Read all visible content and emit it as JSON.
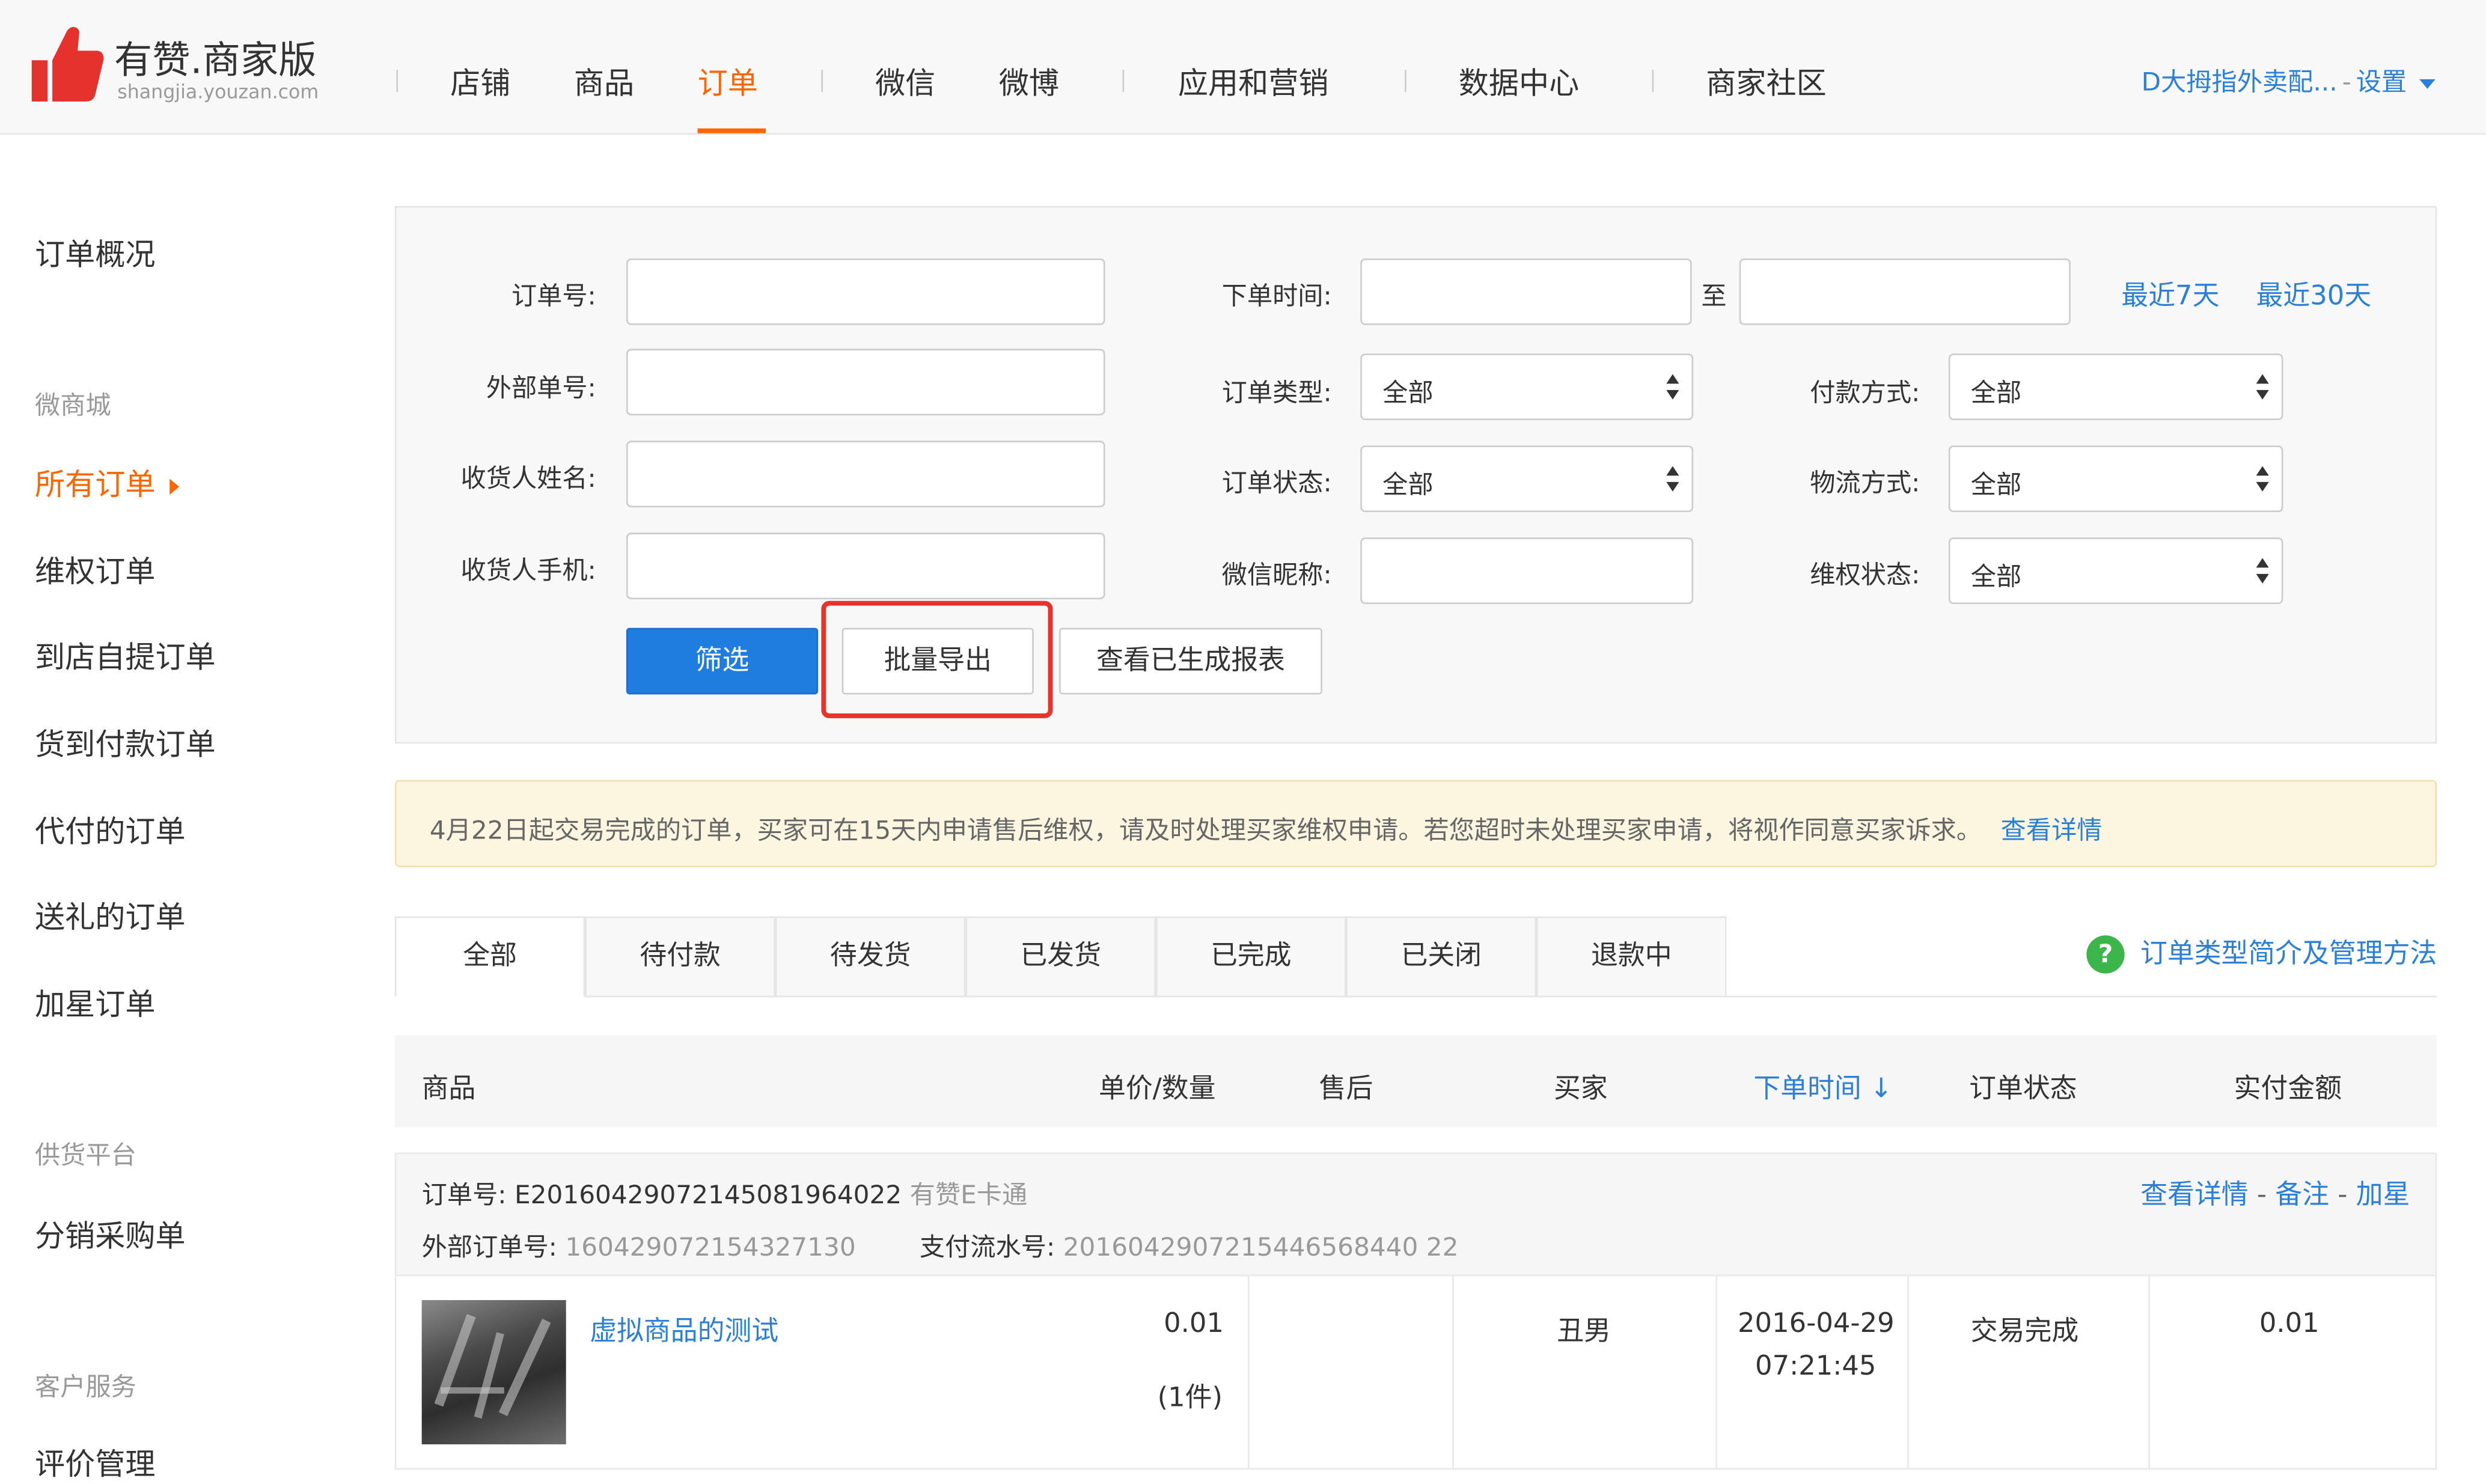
{
  "header": {
    "logo_title": "有赞.商家版",
    "logo_sub": "shangjia.youzan.com",
    "nav": [
      "店铺",
      "商品",
      "订单",
      "微信",
      "微博",
      "应用和营销",
      "数据中心",
      "商家社区"
    ],
    "active_nav": "订单",
    "account_name": "D大拇指外卖配...",
    "account_dash": "-",
    "settings_label": "设置",
    "brand_color": "#ff6600",
    "link_color": "#2c7fd6"
  },
  "sidebar": {
    "items": [
      "订单概况",
      "所有订单",
      "维权订单",
      "到店自提订单",
      "货到付款订单",
      "代付的订单",
      "送礼的订单",
      "加星订单",
      "分销采购单",
      "评价管理"
    ],
    "groups": [
      "微商城",
      "供货平台",
      "客户服务"
    ],
    "active_item": "所有订单"
  },
  "filter": {
    "order_no_label": "订单号:",
    "external_no_label": "外部单号:",
    "receiver_name_label": "收货人姓名:",
    "receiver_phone_label": "收货人手机:",
    "order_time_label": "下单时间:",
    "to_label": "至",
    "last7": "最近7天",
    "last30": "最近30天",
    "order_type_label": "订单类型:",
    "order_status_label": "订单状态:",
    "wechat_nick_label": "微信昵称:",
    "pay_method_label": "付款方式:",
    "logistics_label": "物流方式:",
    "rights_status_label": "维权状态:",
    "order_type_value": "全部",
    "order_status_value": "全部",
    "pay_method_value": "全部",
    "logistics_value": "全部",
    "rights_status_value": "全部",
    "filter_button": "筛选",
    "export_button": "批量导出",
    "reports_button": "查看已生成报表",
    "highlight_color": "#e8322c"
  },
  "notice": {
    "text": "4月22日起交易完成的订单，买家可在15天内申请售后维权，请及时处理买家维权申请。若您超时未处理买家申请，将视作同意买家诉求。",
    "link": "查看详情"
  },
  "tabs": {
    "items": [
      "全部",
      "待付款",
      "待发货",
      "已发货",
      "已完成",
      "已关闭",
      "退款中"
    ],
    "active": "全部",
    "help_link": "订单类型简介及管理方法"
  },
  "table": {
    "headers": [
      "商品",
      "单价/数量",
      "售后",
      "买家",
      "下单时间 ↓",
      "订单状态",
      "实付金额"
    ]
  },
  "order": {
    "order_no_label": "订单号:",
    "order_no": "E20160429072145081964022",
    "card_type": "有赞E卡通",
    "external_no_label": "外部订单号:",
    "external_no": "160429072154327130",
    "payment_flow_label": "支付流水号:",
    "payment_flow": "2016042907215446568440 22",
    "actions": [
      "查看详情",
      "备注",
      "加星"
    ],
    "product_name": "虚拟商品的测试",
    "price": "0.01",
    "quantity": "(1件)",
    "buyer": "丑男",
    "date": "2016-04-29",
    "time": "07:21:45",
    "status": "交易完成",
    "amount": "0.01"
  }
}
